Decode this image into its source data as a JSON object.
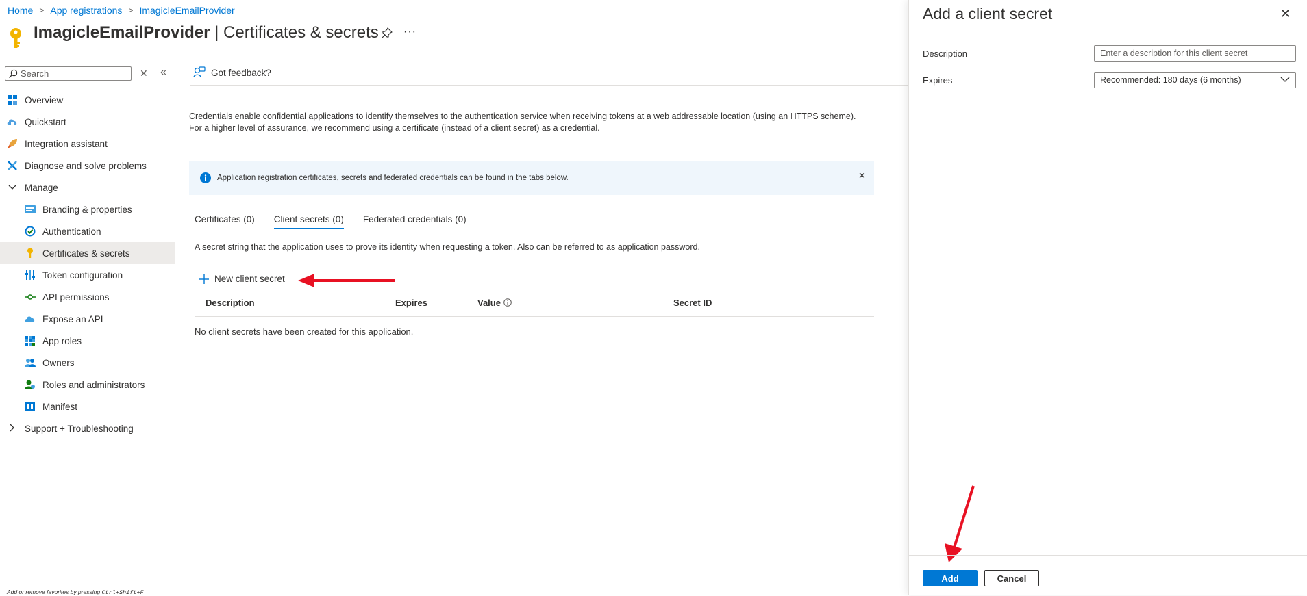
{
  "breadcrumb": [
    "Home",
    "App registrations",
    "ImagicleEmailProvider"
  ],
  "header": {
    "app_name": "ImagicleEmailProvider",
    "separator": " | ",
    "page_name": "Certificates & secrets",
    "more": "···"
  },
  "sidebar": {
    "search_placeholder": "Search",
    "items": [
      {
        "label": "Overview",
        "icon": "overview-icon"
      },
      {
        "label": "Quickstart",
        "icon": "quickstart-icon"
      },
      {
        "label": "Integration assistant",
        "icon": "rocket-icon"
      },
      {
        "label": "Diagnose and solve problems",
        "icon": "wrench-icon"
      },
      {
        "label": "Manage",
        "icon": "chevron-down-icon"
      },
      {
        "label": "Branding & properties",
        "icon": "branding-icon"
      },
      {
        "label": "Authentication",
        "icon": "authentication-icon"
      },
      {
        "label": "Certificates & secrets",
        "icon": "key-icon"
      },
      {
        "label": "Token configuration",
        "icon": "token-icon"
      },
      {
        "label": "API permissions",
        "icon": "api-permissions-icon"
      },
      {
        "label": "Expose an API",
        "icon": "cloud-icon"
      },
      {
        "label": "App roles",
        "icon": "app-roles-icon"
      },
      {
        "label": "Owners",
        "icon": "owners-icon"
      },
      {
        "label": "Roles and administrators",
        "icon": "roles-icon"
      },
      {
        "label": "Manifest",
        "icon": "manifest-icon"
      },
      {
        "label": "Support + Troubleshooting",
        "icon": "chevron-right-icon"
      }
    ],
    "favorites_hint": "Add or remove favorites by pressing ",
    "favorites_shortcut": "Ctrl+Shift+F"
  },
  "content": {
    "feedback": "Got feedback?",
    "description": "Credentials enable confidential applications to identify themselves to the authentication service when receiving tokens at a web addressable location (using an HTTPS scheme). For a higher level of assurance, we recommend using a certificate (instead of a client secret) as a credential.",
    "info_bar": "Application registration certificates, secrets and federated credentials can be found in the tabs below.",
    "tabs": [
      {
        "label": "Certificates (0)",
        "active": false
      },
      {
        "label": "Client secrets (0)",
        "active": true
      },
      {
        "label": "Federated credentials (0)",
        "active": false
      }
    ],
    "tab_description": "A secret string that the application uses to prove its identity when requesting a token. Also can be referred to as application password.",
    "new_secret": "New client secret",
    "columns": [
      "Description",
      "Expires",
      "Value",
      "Secret ID"
    ],
    "empty_message": "No client secrets have been created for this application."
  },
  "panel": {
    "title": "Add a client secret",
    "description_label": "Description",
    "description_placeholder": "Enter a description for this client secret",
    "expires_label": "Expires",
    "expires_value": "Recommended: 180 days (6 months)",
    "add_label": "Add",
    "cancel_label": "Cancel"
  },
  "colors": {
    "accent": "#0078d4",
    "annotation_arrow": "#e81123",
    "info_bar_bg": "#eff6fc",
    "active_nav_bg": "#edebe9"
  }
}
